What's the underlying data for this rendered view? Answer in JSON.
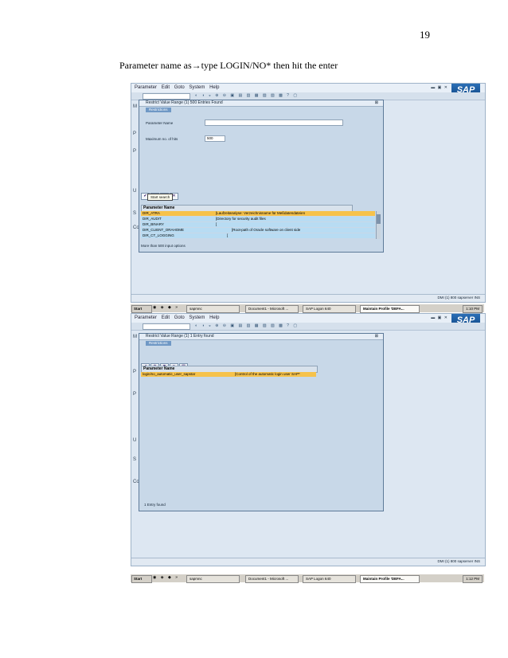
{
  "page_number": "19",
  "caption": {
    "before": "Parameter name as",
    "arrow": "→",
    "after": "type LOGIN/NO* then hit the enter"
  },
  "menu": {
    "items": [
      "Parameter",
      "Edit",
      "Goto",
      "System",
      "Help"
    ],
    "logo": "SAP"
  },
  "screen1": {
    "dialog_title": "Restrict Value Range (1)   500 Entries Found",
    "tab": "Restrictions",
    "param_name_label": "Parameter Name",
    "param_name_value": "",
    "max_hits_label": "Maximum no. of hits",
    "max_hits_value": "500",
    "tooltip": "Start search",
    "results_header": "Parameter Name",
    "rows": [
      {
        "name": "DIR_ATRA",
        "desc": "[Laufzeitanalyse: Verzeichnisname für Meßdatendateien"
      },
      {
        "name": "DIR_AUDIT",
        "desc": "[Directory for security audit files"
      },
      {
        "name": "DIR_BINARY",
        "desc": "["
      },
      {
        "name": "DIR_CLIENT_ORAHOME",
        "desc": "[Root-path of Oracle software on client side"
      },
      {
        "name": "DIR_CT_LOGGING",
        "desc": "["
      }
    ],
    "footer": "More than  500 input options",
    "status": "DMI (1) 800   sapserver  INS"
  },
  "taskbar1": {
    "start": "Start",
    "tasks": [
      "sapmnc",
      "Document1 - Microsoft ...",
      "SAP Logon 640",
      "Maintain Profile 'DEFA..."
    ],
    "clock": "1:10 PM"
  },
  "screen2": {
    "dialog_title": "Restrict Value Range (1)   1 Entry found",
    "tab": "Restrictions",
    "results_header": "Parameter Name",
    "rows": [
      {
        "name": "login/no_automatic_user_sapstar",
        "desc": "[Control of the automatic login user SAP*"
      }
    ],
    "footer": "1 Entry found",
    "status": "DMI (1) 800   sapserver  INS"
  },
  "taskbar2": {
    "start": "Start",
    "tasks": [
      "sapmnc",
      "Document1 - Microsoft ...",
      "SAP Logon 640",
      "Maintain Profile 'DEFA..."
    ],
    "clock": "1:12 PM"
  },
  "colors": {
    "selected_row": "#f6c24b",
    "alt_row": "#b8dcf3",
    "sap_blue": "#2c6fb6"
  }
}
